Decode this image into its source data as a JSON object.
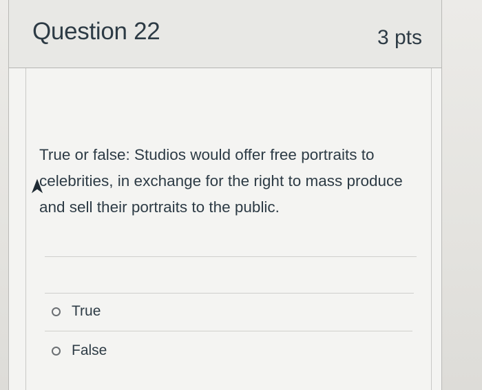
{
  "question": {
    "title": "Question 22",
    "points": "3 pts",
    "text": "True or false: Studios would offer free portraits to celebrities, in exchange for the right to mass produce and sell their portraits to the public."
  },
  "answers": [
    {
      "label": "True",
      "selected": false
    },
    {
      "label": "False",
      "selected": false
    }
  ],
  "colors": {
    "text": "#2d3b45",
    "header_background": "#e8e8e5",
    "border": "#b6b6b3"
  }
}
